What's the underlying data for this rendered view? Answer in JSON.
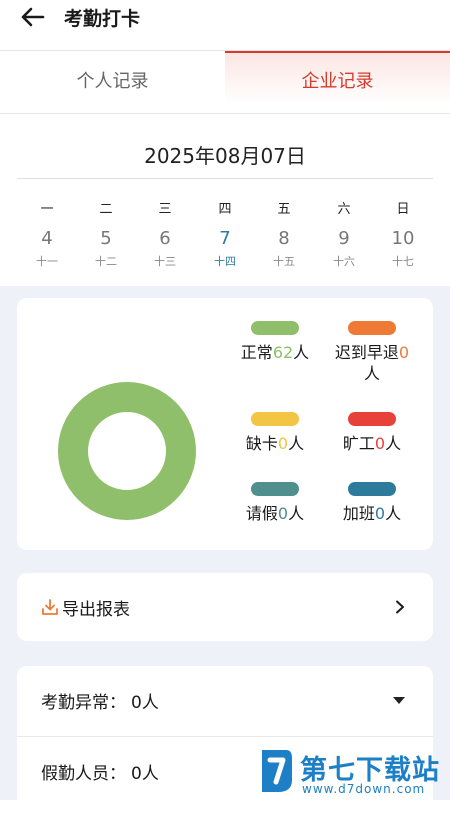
{
  "header": {
    "title": "考勤打卡",
    "back_icon": "arrow-left-icon"
  },
  "tabs": [
    {
      "label": "个人记录",
      "active": false
    },
    {
      "label": "企业记录",
      "active": true
    }
  ],
  "accent_color": "#d63a2a",
  "date": "2025年08月07日",
  "week": [
    {
      "weekday": "一",
      "day": "4",
      "lunar": "十一",
      "selected": false
    },
    {
      "weekday": "二",
      "day": "5",
      "lunar": "十二",
      "selected": false
    },
    {
      "weekday": "三",
      "day": "6",
      "lunar": "十三",
      "selected": false
    },
    {
      "weekday": "四",
      "day": "7",
      "lunar": "十四",
      "selected": true
    },
    {
      "weekday": "五",
      "day": "8",
      "lunar": "十五",
      "selected": false
    },
    {
      "weekday": "六",
      "day": "9",
      "lunar": "十六",
      "selected": false
    },
    {
      "weekday": "日",
      "day": "10",
      "lunar": "十七",
      "selected": false
    }
  ],
  "stats": {
    "unit": "人",
    "items": [
      {
        "label": "正常",
        "count": "62",
        "color": "#8fbf6a"
      },
      {
        "label": "迟到早退",
        "count": "0",
        "color": "#ee7a36"
      },
      {
        "label": "缺卡",
        "count": "0",
        "color": "#f2c545"
      },
      {
        "label": "旷工",
        "count": "0",
        "color": "#e8413a"
      },
      {
        "label": "请假",
        "count": "0",
        "color": "#4f8f8d"
      },
      {
        "label": "加班",
        "count": "0",
        "color": "#2e7a9a"
      }
    ],
    "donut_color": "#8fbf6a"
  },
  "export": {
    "label": "导出报表",
    "icon": "download-icon"
  },
  "list": [
    {
      "label": "考勤异常：",
      "value": "0人"
    },
    {
      "label": "假勤人员：",
      "value": "0人"
    }
  ],
  "watermark": {
    "text": "第七下载站",
    "sub": "www.d7down.com"
  }
}
